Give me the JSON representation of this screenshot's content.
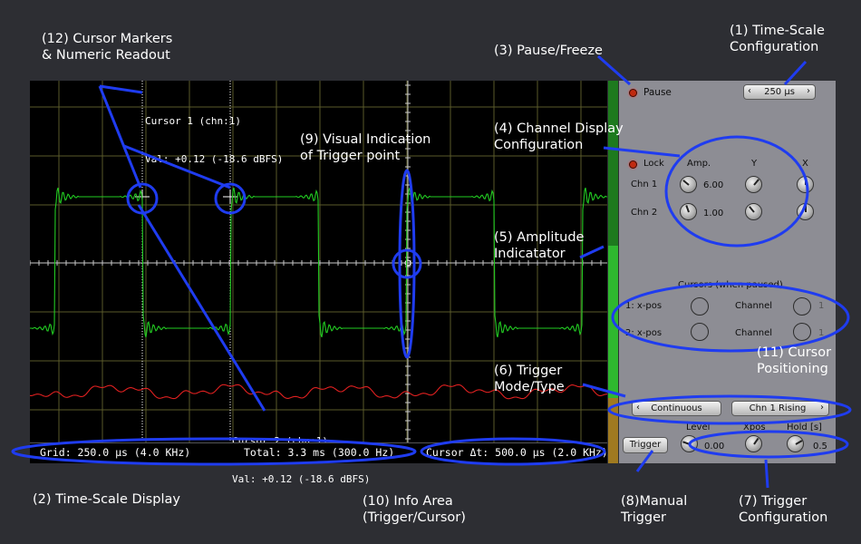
{
  "scope": {
    "cursor1_label": "Cursor 1 (chn:1)",
    "cursor1_value": "Val: +0.12 (-18.6 dBFS)",
    "cursor2_label": "Cursor 2 (chn:1)",
    "cursor2_value": "Val: +0.12 (-18.6 dBFS)",
    "info_grid": "Grid: 250.0 µs (4.0 KHz)",
    "info_total": "Total: 3.3 ms (300.0 Hz)",
    "info_cursor": "Cursor Δt: 500.0 µs (2.0 KHz)",
    "trace1_color": "#22cc22",
    "trace2_color": "#e02020",
    "grid_color": "#5a5a2a"
  },
  "panel": {
    "pause_label": "Pause",
    "timescale_value": "250 µs",
    "lock_label": "Lock",
    "col_amp": "Amp.",
    "col_y": "Y",
    "col_x": "X",
    "chn1_label": "Chn 1",
    "chn1_amp": "6.00",
    "chn2_label": "Chn 2",
    "chn2_amp": "1.00",
    "cursors_title": "Cursors (when paused)",
    "cursor1_xpos": "1: x-pos",
    "cursor2_xpos": "2: x-pos",
    "channel_label": "Channel",
    "cursor1_channel": "1",
    "cursor2_channel": "1",
    "trigger_mode": "Continuous",
    "trigger_type": "Chn 1 Rising",
    "level_label": "Level",
    "xpos_label": "Xpos",
    "hold_label": "Hold [s]",
    "trigger_button": "Trigger",
    "level_value": "0.00",
    "hold_value": "0.5"
  },
  "annotations": {
    "a1": "(1) Time-Scale\nConfiguration",
    "a2": "(2) Time-Scale Display",
    "a3": "(3) Pause/Freeze",
    "a4": "(4) Channel Display\nConfiguration",
    "a5": "(5) Amplitude\nIndicatator",
    "a6": "(6) Trigger\nMode/Type",
    "a7": "(7) Trigger\nConfiguration",
    "a8": "(8)Manual\nTrigger",
    "a9": "(9) Visual Indication\nof Trigger point",
    "a10": "(10) Info Area\n(Trigger/Cursor)",
    "a11": "(11) Cursor\nPositioning",
    "a12": "(12) Cursor Markers\n& Numeric Readout"
  }
}
